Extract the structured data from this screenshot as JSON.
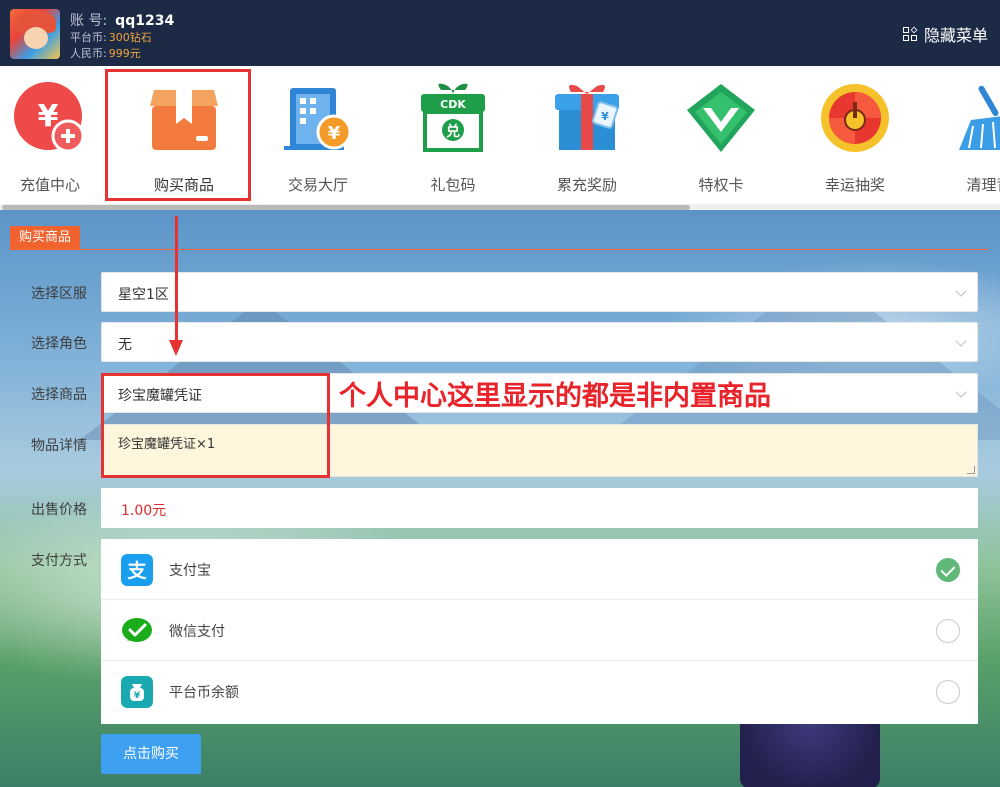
{
  "header": {
    "account_label": "账  号:",
    "account_value": "qq1234",
    "platform_coin_label": "平台币:",
    "platform_coin_value": "300钻石",
    "rmb_label": "人民币:",
    "rmb_value": "999元",
    "hide_menu_label": "隐藏菜单"
  },
  "menu": {
    "items": [
      {
        "label": "充值中心",
        "icon": "recharge-icon"
      },
      {
        "label": "购买商品",
        "icon": "box-icon"
      },
      {
        "label": "交易大厅",
        "icon": "building-icon"
      },
      {
        "label": "礼包码",
        "icon": "cdk-gift-icon"
      },
      {
        "label": "累充奖励",
        "icon": "gift-box-icon"
      },
      {
        "label": "特权卡",
        "icon": "v-badge-icon"
      },
      {
        "label": "幸运抽奖",
        "icon": "lucky-wheel-icon"
      },
      {
        "label": "清理背",
        "icon": "broom-icon"
      }
    ],
    "selected_index": 1,
    "scroll_fraction": 0.69
  },
  "section": {
    "title": "购买商品"
  },
  "form": {
    "server": {
      "label": "选择区服",
      "value": "星空1区"
    },
    "role": {
      "label": "选择角色",
      "value": "无"
    },
    "product": {
      "label": "选择商品",
      "value": "珍宝魔罐凭证"
    },
    "details": {
      "label": "物品详情",
      "value": "珍宝魔罐凭证×1"
    },
    "price": {
      "label": "出售价格",
      "value": "1.00元"
    },
    "payment": {
      "label": "支付方式",
      "options": [
        {
          "label": "支付宝",
          "icon": "alipay-icon",
          "selected": true
        },
        {
          "label": "微信支付",
          "icon": "wechat-pay-icon",
          "selected": false
        },
        {
          "label": "平台币余额",
          "icon": "wallet-icon",
          "selected": false
        }
      ]
    },
    "submit_label": "点击购买"
  },
  "annotation": {
    "text": "个人中心这里显示的都是非内置商品"
  },
  "colors": {
    "header_bg": "#1d2a45",
    "accent": "#f0622e",
    "annotation_red": "#e53333",
    "price_red": "#e0292c",
    "button_blue": "#3ea0f0",
    "selected_green": "#5fb878"
  }
}
